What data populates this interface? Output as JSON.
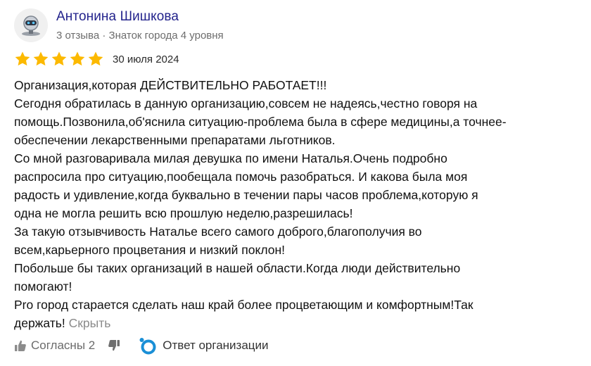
{
  "author": {
    "name": "Антонина Шишкова",
    "stats": "3 отзыва · Знаток города 4 уровня",
    "avatar_icon": "robot-avatar-icon"
  },
  "rating": {
    "stars": 5,
    "max": 5,
    "color": "#fcb900"
  },
  "date": "30 июля 2024",
  "review_lines": [
    "Организация,которая ДЕЙСТВИТЕЛЬНО РАБОТАЕТ!!!",
    "Сегодня обратилась в данную организацию,совсем не надеясь,честно говоря на",
    "помощь.Позвонила,об'яснила ситуацию-проблема была в сфере медицины,а точнее-",
    "обеспечении лекарственными препаратами льготников.",
    "Со мной разговаривала милая девушка по имени Наталья.Очень подробно",
    "распросила про ситуацию,пообещала помочь разобраться. И какова была моя",
    "радость и удивление,когда буквально в течении пары часов проблема,которую я",
    "одна не могла решить всю прошлую неделю,разрешилась!",
    "За такую отзывчивость Наталье всего самого доброго,благополучия во",
    "всем,карьерного процветания и низкий поклон!",
    "Побольше бы таких организаций в нашей области.Когда люди действительно",
    "помогают!",
    "Pro город старается сделать наш край более процветающим и комфортным!Так"
  ],
  "review_last_line": "держать!",
  "hide_label": "Скрыть",
  "actions": {
    "agree_label": "Согласны 2",
    "org_reply_label": "Ответ организации",
    "accent_color": "#1a8fd6"
  }
}
